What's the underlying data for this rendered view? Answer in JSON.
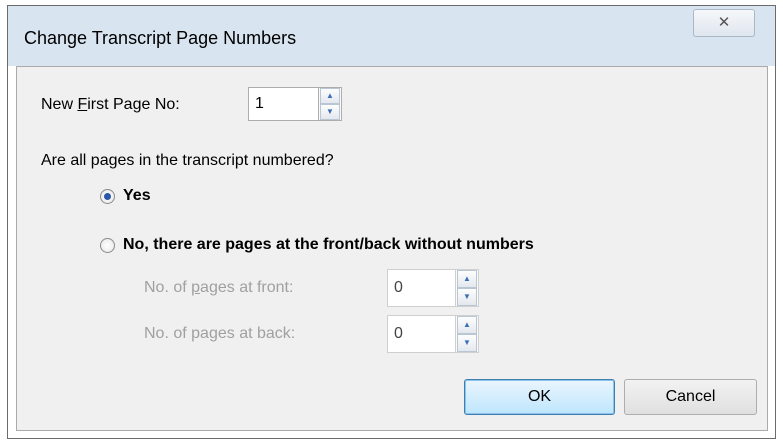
{
  "dialog": {
    "title": "Change Transcript Page Numbers",
    "close_glyph": "✕"
  },
  "first_page": {
    "label_pre": "New ",
    "label_hotkey": "F",
    "label_post": "irst Page No:",
    "value": "1"
  },
  "question": "Are all pages in the transcript numbered?",
  "options": {
    "yes_label": "Yes",
    "no_label": "No, there are pages at the front/back without numbers",
    "selected": "yes"
  },
  "front_pages": {
    "label_pre": "No. of ",
    "label_hotkey": "p",
    "label_post": "ages at front:",
    "value": "0"
  },
  "back_pages": {
    "label_pre": "No. of pa",
    "label_hotkey": "g",
    "label_post": "es at back:",
    "value": "0"
  },
  "buttons": {
    "ok": "OK",
    "cancel": "Cancel"
  },
  "icons": {
    "spin_up": "▲",
    "spin_down": "▼"
  }
}
